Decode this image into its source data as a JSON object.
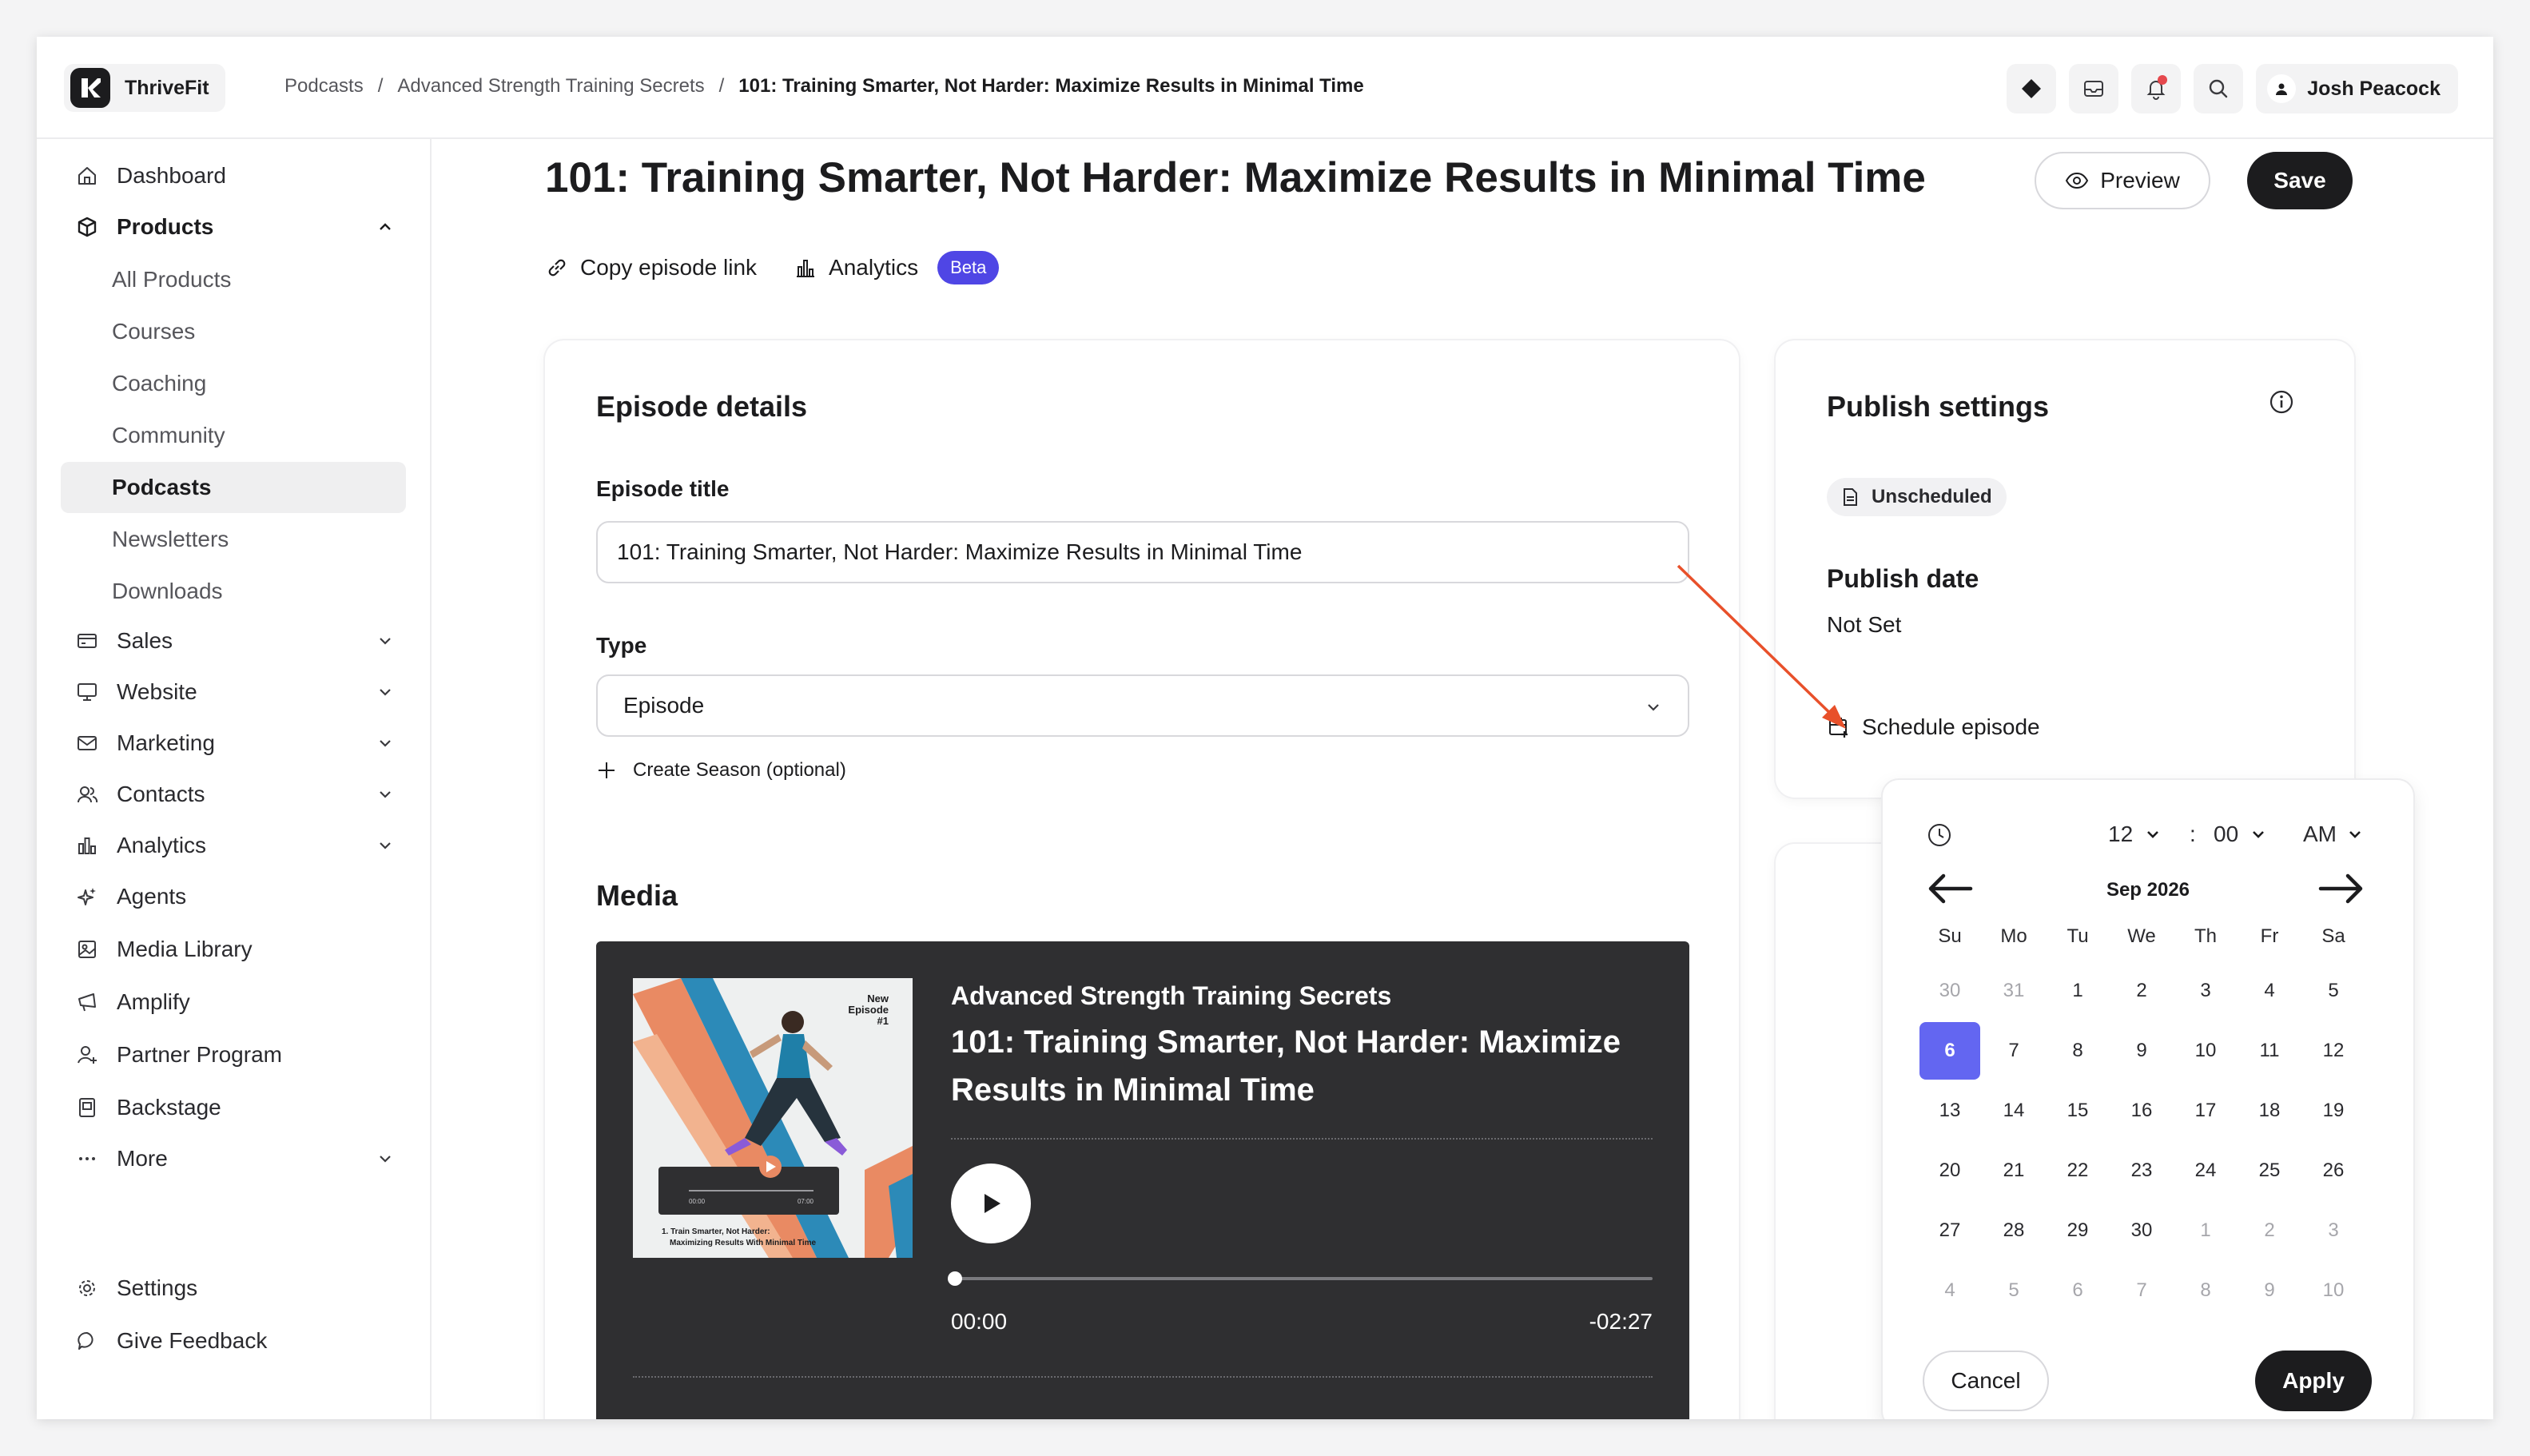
{
  "app": {
    "name": "ThriveFit"
  },
  "breadcrumb": [
    "Podcasts",
    "Advanced Strength Training Secrets",
    "101: Training Smarter, Not Harder: Maximize Results in Minimal Time"
  ],
  "user": {
    "name": "Josh Peacock"
  },
  "sidebar": {
    "dashboard": "Dashboard",
    "products": "Products",
    "products_sub": [
      "All Products",
      "Courses",
      "Coaching",
      "Community",
      "Podcasts",
      "Newsletters",
      "Downloads"
    ],
    "sales": "Sales",
    "website": "Website",
    "marketing": "Marketing",
    "contacts": "Contacts",
    "analytics": "Analytics",
    "agents": "Agents",
    "media_library": "Media Library",
    "amplify": "Amplify",
    "partner_program": "Partner Program",
    "backstage": "Backstage",
    "more": "More",
    "settings": "Settings",
    "feedback": "Give Feedback"
  },
  "page": {
    "title": "101: Training Smarter, Not Harder: Maximize Results in Minimal Time",
    "preview_label": "Preview",
    "save_label": "Save",
    "copy_link_label": "Copy episode link",
    "analytics_label": "Analytics",
    "beta_label": "Beta"
  },
  "episode_details": {
    "heading": "Episode details",
    "title_label": "Episode title",
    "title_value": "101: Training Smarter, Not Harder: Maximize Results in Minimal Time",
    "type_label": "Type",
    "type_value": "Episode",
    "create_season": "Create Season (optional)",
    "media_heading": "Media"
  },
  "player": {
    "show": "Advanced Strength Training Secrets",
    "episode": "101: Training Smarter, Not Harder: Maximize Results in Minimal Time",
    "current_time": "00:00",
    "remaining_time": "-02:27",
    "progress": 0,
    "cover": {
      "tag_line1": "New",
      "tag_line2": "Episode",
      "tag_line3": "#1",
      "caption_line1": "1. Train Smarter, Not Harder:",
      "caption_line2": "Maximizing Results With Minimal Time",
      "mini_start": "00:00",
      "mini_end": "07:00"
    }
  },
  "publish": {
    "heading": "Publish settings",
    "status": "Unscheduled",
    "date_label": "Publish date",
    "date_value": "Not Set",
    "schedule_label": "Schedule episode"
  },
  "picker": {
    "hour": "12",
    "separator": ":",
    "minute": "00",
    "ampm": "AM",
    "month_label": "Sep 2026",
    "weekdays": [
      "Su",
      "Mo",
      "Tu",
      "We",
      "Th",
      "Fr",
      "Sa"
    ],
    "weeks": [
      [
        "30",
        "31",
        "1",
        "2",
        "3",
        "4",
        "5"
      ],
      [
        "6",
        "7",
        "8",
        "9",
        "10",
        "11",
        "12"
      ],
      [
        "13",
        "14",
        "15",
        "16",
        "17",
        "18",
        "19"
      ],
      [
        "20",
        "21",
        "22",
        "23",
        "24",
        "25",
        "26"
      ],
      [
        "27",
        "28",
        "29",
        "30",
        "1",
        "2",
        "3"
      ],
      [
        "4",
        "5",
        "6",
        "7",
        "8",
        "9",
        "10"
      ]
    ],
    "selected": "6",
    "cancel_label": "Cancel",
    "apply_label": "Apply"
  },
  "colors": {
    "accent": "#6366f1",
    "beta_badge": "#4f46e5",
    "dark_button": "#1c1c1e",
    "annotation_arrow": "#e8502a",
    "player_bg": "#2f2f31"
  }
}
